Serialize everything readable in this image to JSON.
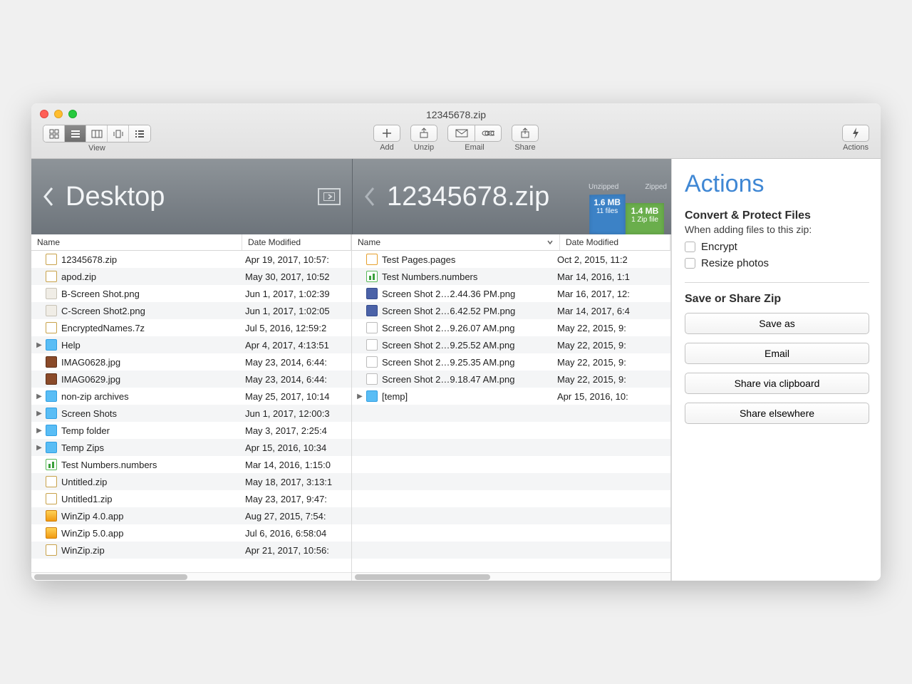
{
  "window": {
    "title": "12345678.zip"
  },
  "toolbar": {
    "view_label": "View",
    "add": "Add",
    "unzip": "Unzip",
    "email": "Email",
    "share": "Share",
    "actions": "Actions"
  },
  "location": {
    "left_title": "Desktop",
    "right_title": "12345678.zip",
    "unzipped_label": "Unzipped",
    "zipped_label": "Zipped",
    "unzipped_size": "1.6 MB",
    "unzipped_count": "11 files",
    "zipped_size": "1.4 MB",
    "zipped_count": "1 Zip file"
  },
  "columns": {
    "name": "Name",
    "date": "Date Modified"
  },
  "left_files": [
    {
      "icon": "zip",
      "name": "12345678.zip",
      "date": "Apr 19, 2017, 10:57:"
    },
    {
      "icon": "zip",
      "name": "apod.zip",
      "date": "May 30, 2017, 10:52"
    },
    {
      "icon": "img2",
      "name": "B-Screen Shot.png",
      "date": "Jun 1, 2017, 1:02:39"
    },
    {
      "icon": "img2",
      "name": "C-Screen Shot2.png",
      "date": "Jun 1, 2017, 1:02:05"
    },
    {
      "icon": "zip",
      "name": "EncryptedNames.7z",
      "date": "Jul 5, 2016, 12:59:2"
    },
    {
      "icon": "fold",
      "name": "Help",
      "date": "Apr 4, 2017, 4:13:51",
      "expandable": true
    },
    {
      "icon": "jpg",
      "name": "IMAG0628.jpg",
      "date": "May 23, 2014, 6:44:"
    },
    {
      "icon": "jpg",
      "name": "IMAG0629.jpg",
      "date": "May 23, 2014, 6:44:"
    },
    {
      "icon": "fold",
      "name": "non-zip archives",
      "date": "May 25, 2017, 10:14",
      "expandable": true
    },
    {
      "icon": "fold",
      "name": "Screen Shots",
      "date": "Jun 1, 2017, 12:00:3",
      "expandable": true
    },
    {
      "icon": "fold",
      "name": "Temp folder",
      "date": "May 3, 2017, 2:25:4",
      "expandable": true
    },
    {
      "icon": "fold",
      "name": "Temp Zips",
      "date": "Apr 15, 2016, 10:34",
      "expandable": true
    },
    {
      "icon": "num",
      "name": "Test Numbers.numbers",
      "date": "Mar 14, 2016, 1:15:0"
    },
    {
      "icon": "zip",
      "name": "Untitled.zip",
      "date": "May 18, 2017, 3:13:1"
    },
    {
      "icon": "zip",
      "name": "Untitled1.zip",
      "date": "May 23, 2017, 9:47:"
    },
    {
      "icon": "app",
      "name": "WinZip 4.0.app",
      "date": "Aug 27, 2015, 7:54:"
    },
    {
      "icon": "app",
      "name": "WinZip 5.0.app",
      "date": "Jul 6, 2016, 6:58:04"
    },
    {
      "icon": "zip",
      "name": "WinZip.zip",
      "date": "Apr 21, 2017, 10:56:"
    }
  ],
  "right_files": [
    {
      "icon": "pgs",
      "name": "Test Pages.pages",
      "date": "Oct 2, 2015, 11:2"
    },
    {
      "icon": "num",
      "name": "Test Numbers.numbers",
      "date": "Mar 14, 2016, 1:1"
    },
    {
      "icon": "png2",
      "name": "Screen Shot 2…2.44.36 PM.png",
      "date": "Mar 16, 2017, 12:"
    },
    {
      "icon": "png2",
      "name": "Screen Shot 2…6.42.52 PM.png",
      "date": "Mar 14, 2017, 6:4"
    },
    {
      "icon": "png",
      "name": "Screen Shot 2…9.26.07 AM.png",
      "date": "May 22, 2015, 9:"
    },
    {
      "icon": "png",
      "name": "Screen Shot 2…9.25.52 AM.png",
      "date": "May 22, 2015, 9:"
    },
    {
      "icon": "png",
      "name": "Screen Shot 2…9.25.35 AM.png",
      "date": "May 22, 2015, 9:"
    },
    {
      "icon": "png",
      "name": "Screen Shot 2…9.18.47 AM.png",
      "date": "May 22, 2015, 9:"
    },
    {
      "icon": "fold",
      "name": "[temp]",
      "date": "Apr 15, 2016, 10:",
      "expandable": true
    }
  ],
  "actions": {
    "title": "Actions",
    "convert_title": "Convert & Protect Files",
    "convert_sub": "When adding files to this zip:",
    "encrypt": "Encrypt",
    "resize": "Resize photos",
    "share_title": "Save or Share Zip",
    "btn_save_as": "Save as",
    "btn_email": "Email",
    "btn_clip": "Share via clipboard",
    "btn_else": "Share elsewhere"
  }
}
